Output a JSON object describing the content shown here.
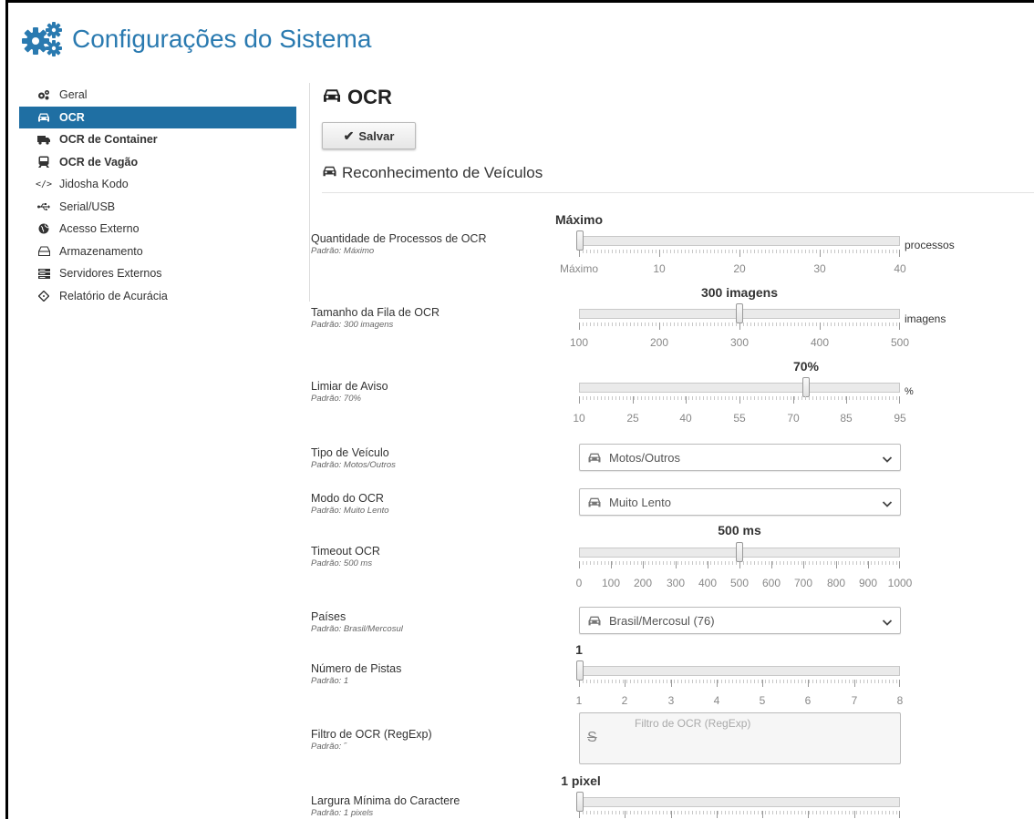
{
  "header": {
    "title": "Configurações do Sistema"
  },
  "sidebar": {
    "items": [
      {
        "label": "Geral",
        "icon": "gears-icon"
      },
      {
        "label": "OCR",
        "icon": "car-icon"
      },
      {
        "label": "OCR de Container",
        "icon": "truck-icon"
      },
      {
        "label": "OCR de Vagão",
        "icon": "train-icon"
      },
      {
        "label": "Jidosha Kodo",
        "icon": "code-icon"
      },
      {
        "label": "Serial/USB",
        "icon": "usb-icon"
      },
      {
        "label": "Acesso Externo",
        "icon": "globe-icon"
      },
      {
        "label": "Armazenamento",
        "icon": "hdd-icon"
      },
      {
        "label": "Servidores Externos",
        "icon": "server-icon"
      },
      {
        "label": "Relatório de Acurácia",
        "icon": "crosshairs-icon"
      }
    ],
    "active": "OCR"
  },
  "main": {
    "title": "OCR",
    "save_label": "Salvar",
    "section_title": "Reconhecimento de Veículos"
  },
  "settings": {
    "processos": {
      "label": "Quantidade de Processos de OCR",
      "hint": "Padrão: Máximo",
      "value": "Máximo",
      "unit": "processos",
      "ticks": [
        "Máximo",
        "10",
        "20",
        "30",
        "40"
      ],
      "fraction": 0
    },
    "fila": {
      "label": "Tamanho da Fila de OCR",
      "hint": "Padrão: 300 imagens",
      "value": "300 imagens",
      "unit": "imagens",
      "ticks": [
        "100",
        "200",
        "300",
        "400",
        "500"
      ],
      "fraction": 0.5
    },
    "aviso": {
      "label": "Limiar de Aviso",
      "hint": "Padrão: 70%",
      "value": "70%",
      "unit": "%",
      "ticks": [
        "10",
        "25",
        "40",
        "55",
        "70",
        "85",
        "95"
      ],
      "fraction": 0.706
    },
    "tipo": {
      "label": "Tipo de Veículo",
      "hint": "Padrão: Motos/Outros",
      "selected": "Motos/Outros"
    },
    "modo": {
      "label": "Modo do OCR",
      "hint": "Padrão: Muito Lento",
      "selected": "Muito Lento"
    },
    "timeout": {
      "label": "Timeout OCR",
      "hint": "Padrão: 500 ms",
      "value": "500 ms",
      "ticks": [
        "0",
        "100",
        "200",
        "300",
        "400",
        "500",
        "600",
        "700",
        "800",
        "900",
        "1000"
      ],
      "fraction": 0.5
    },
    "paises": {
      "label": "Países",
      "hint": "Padrão: Brasil/Mercosul",
      "selected": "Brasil/Mercosul (76)"
    },
    "pistas": {
      "label": "Número de Pistas",
      "hint": "Padrão: 1",
      "value": "1",
      "ticks": [
        "1",
        "2",
        "3",
        "4",
        "5",
        "6",
        "7",
        "8"
      ],
      "fraction": 0
    },
    "filtro": {
      "label": "Filtro de OCR (RegExp)",
      "hint": "Padrão: ˝",
      "placeholder": "Filtro de OCR (RegExp)",
      "strike_glyph": "S"
    },
    "largura": {
      "label": "Largura Mínima do Caractere",
      "hint": "Padrão: 1 pixels",
      "value": "1 pixel",
      "fraction": 0
    }
  },
  "colors": {
    "accent": "#2a7ab0",
    "active_bg": "#1f6fa3"
  }
}
